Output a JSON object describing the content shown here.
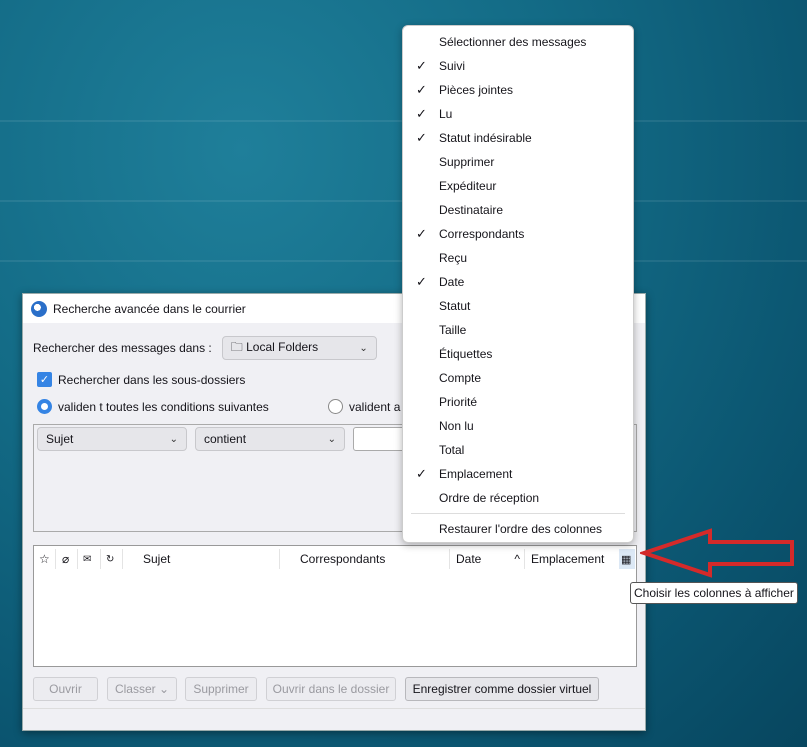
{
  "dialog": {
    "title": "Recherche avancée dans le courrier",
    "search_in_label": "Rechercher des messages dans :",
    "folder": "Local Folders",
    "subfolders_label": "Rechercher dans les sous-dossiers",
    "subfolders_checked": true,
    "match_all_label": "validen t toutes les conditions suivantes",
    "match_any_label": "valident a",
    "condition": {
      "field": "Sujet",
      "operator": "contient",
      "value": ""
    }
  },
  "columns": [
    "Sujet",
    "Correspondants",
    "Date",
    "Emplacement"
  ],
  "icon_columns": [
    "star-icon",
    "attachment-icon",
    "junk-icon",
    "read-icon"
  ],
  "buttons": {
    "open": "Ouvrir",
    "file": "Classer",
    "delete": "Supprimer",
    "open_in_folder": "Ouvrir dans le dossier",
    "save_virtual": "Enregistrer comme dossier virtuel"
  },
  "menu": {
    "items": [
      {
        "label": "Sélectionner des messages",
        "checked": false
      },
      {
        "label": "Suivi",
        "checked": true
      },
      {
        "label": "Pièces jointes",
        "checked": true
      },
      {
        "label": "Lu",
        "checked": true
      },
      {
        "label": "Statut indésirable",
        "checked": true
      },
      {
        "label": "Supprimer",
        "checked": false
      },
      {
        "label": "Expéditeur",
        "checked": false
      },
      {
        "label": "Destinataire",
        "checked": false
      },
      {
        "label": "Correspondants",
        "checked": true
      },
      {
        "label": "Reçu",
        "checked": false
      },
      {
        "label": "Date",
        "checked": true
      },
      {
        "label": "Statut",
        "checked": false
      },
      {
        "label": "Taille",
        "checked": false
      },
      {
        "label": "Étiquettes",
        "checked": false
      },
      {
        "label": "Compte",
        "checked": false
      },
      {
        "label": "Priorité",
        "checked": false
      },
      {
        "label": "Non lu",
        "checked": false
      },
      {
        "label": "Total",
        "checked": false
      },
      {
        "label": "Emplacement",
        "checked": true
      },
      {
        "label": "Ordre de réception",
        "checked": false
      }
    ],
    "restore": "Restaurer l'ordre des colonnes"
  },
  "tooltip": "Choisir les colonnes à afficher",
  "colors": {
    "accent": "#3584e4",
    "arrow": "#d42a2a"
  }
}
